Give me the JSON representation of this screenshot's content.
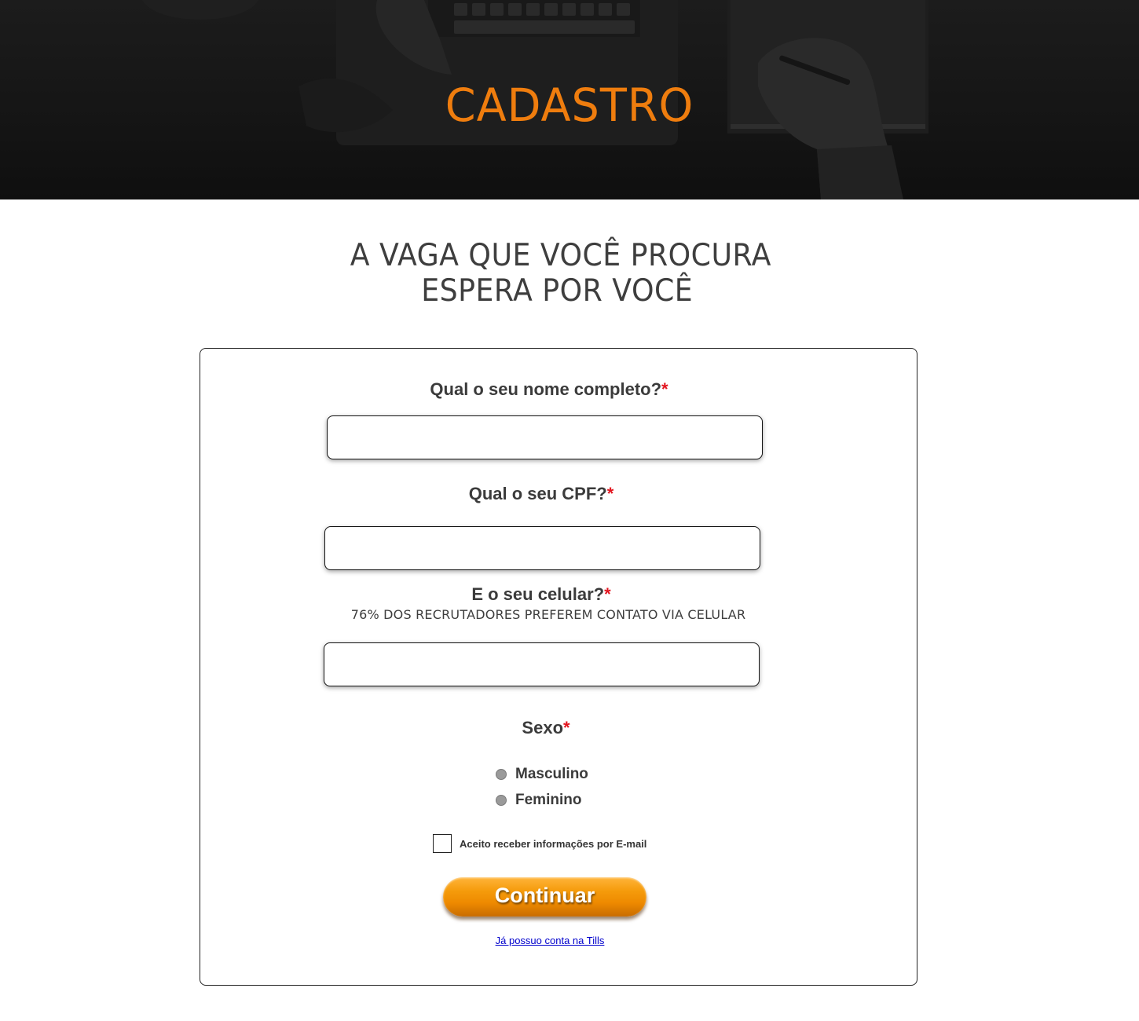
{
  "hero": {
    "title": "CADASTRO"
  },
  "headline": {
    "line1": "A VAGA QUE VOCÊ PROCURA",
    "line2": "ESPERA POR VOCÊ"
  },
  "form": {
    "name_label": "Qual o seu nome completo?",
    "cpf_label": "Qual o seu CPF?",
    "phone_label": "E o seu celular?",
    "phone_hint": "76% DOS RECRUTADORES PREFEREM CONTATO VIA CELULAR",
    "sex_label": "Sexo",
    "required_mark": "*",
    "sex_options": [
      "Masculino",
      "Feminino"
    ],
    "email_optin_label": "Aceito receber informações por E-mail",
    "submit_label": "Continuar",
    "login_link": "Já possuo conta na Tills"
  },
  "colors": {
    "accent": "#ef7d0e",
    "required": "#e3141e",
    "link": "#0000cc",
    "button": "#f59b0b"
  }
}
